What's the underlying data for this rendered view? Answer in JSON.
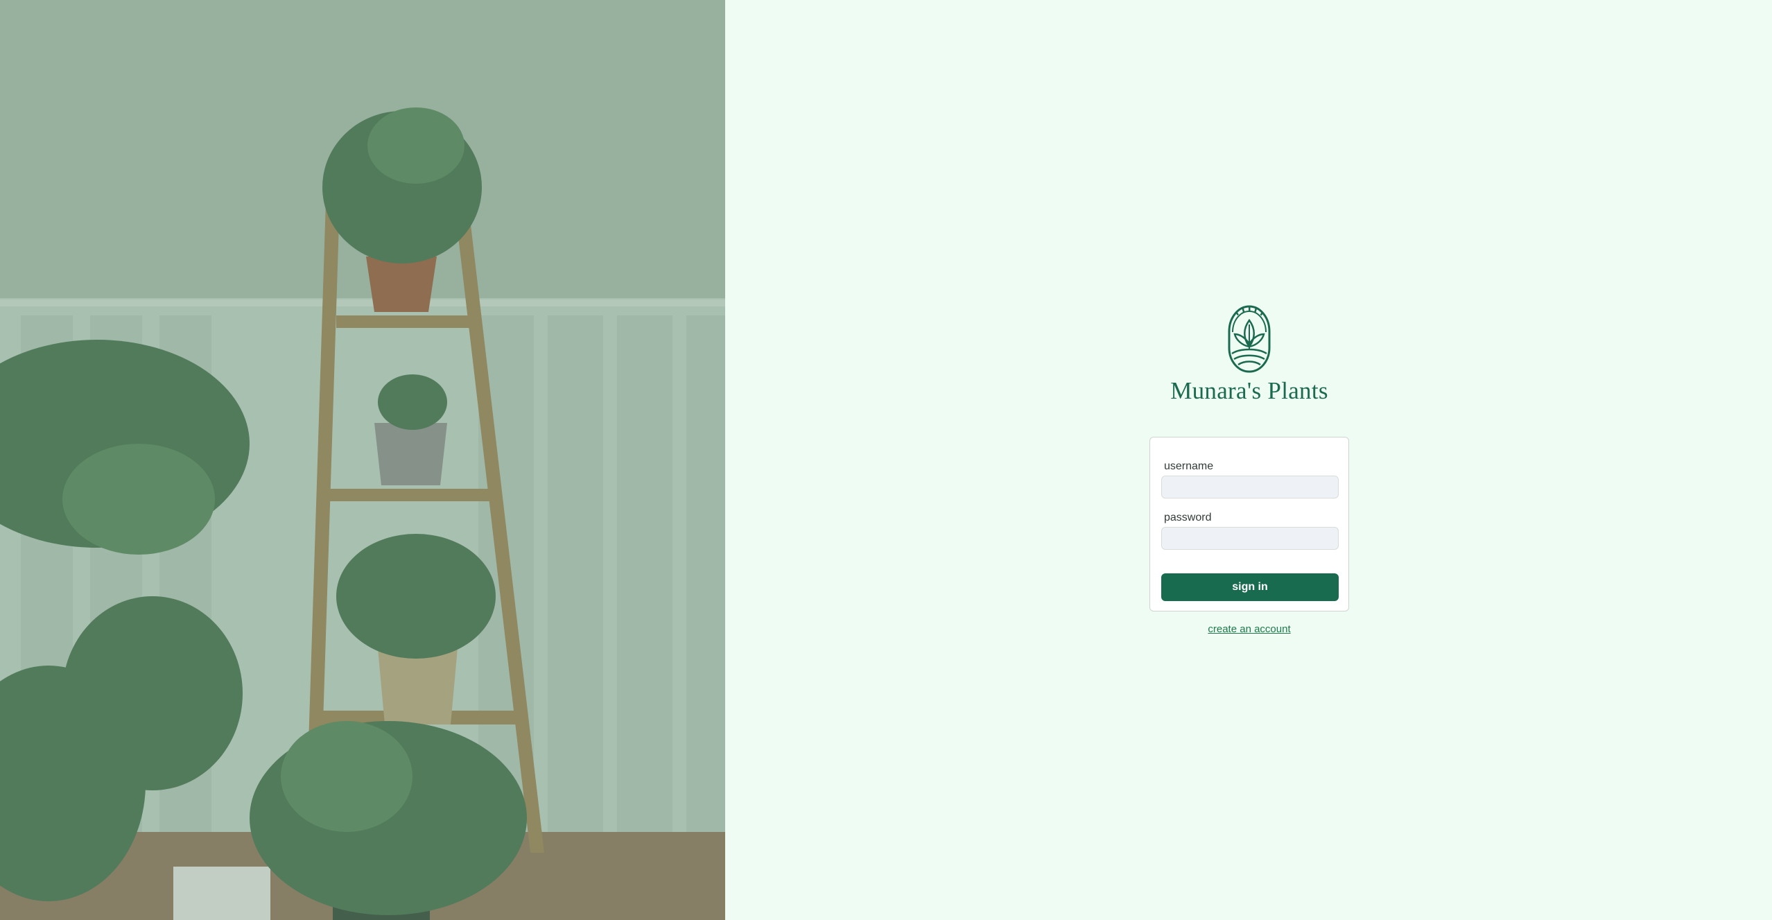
{
  "brand": {
    "name": "Munara's Plants",
    "logo_icon": "leaf-arch-emblem-icon"
  },
  "hero": {
    "image": "plants-on-ladder-shelf-photo"
  },
  "login_form": {
    "username_label": "username",
    "username_value": "",
    "password_label": "password",
    "password_value": "",
    "submit_label": "sign in"
  },
  "links": {
    "create_account": "create an account"
  },
  "colors": {
    "brand_green": "#1b6a4f",
    "button_green": "#196b50",
    "link_green": "#1f7a4a",
    "page_background": "#effcf4",
    "hero_tint": "#95ad9c"
  }
}
